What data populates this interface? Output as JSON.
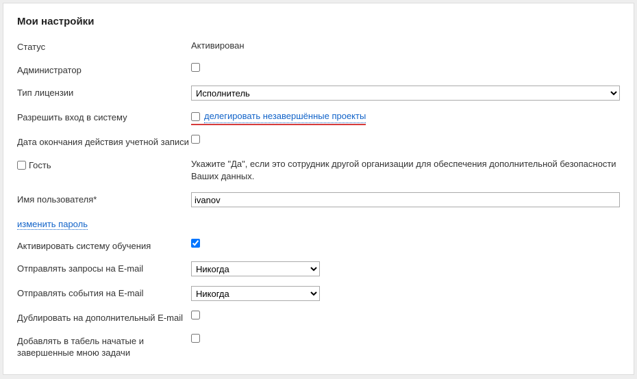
{
  "title": "Мои настройки",
  "rows": {
    "status": {
      "label": "Статус",
      "value": "Активирован"
    },
    "admin": {
      "label": "Администратор"
    },
    "licenseType": {
      "label": "Тип лицензии",
      "selected": "Исполнитель"
    },
    "allowLogin": {
      "label": "Разрешить вход в систему",
      "link": "делегировать незавершённые проекты"
    },
    "accountEnd": {
      "label": "Дата окончания действия учетной записи"
    },
    "guest": {
      "label": "Гость",
      "hint": "Укажите \"Да\", если это сотрудник другой организации для обеспечения дополнительной безопасности Ваших данных."
    },
    "username": {
      "label": "Имя пользователя*",
      "value": "ivanov"
    },
    "changePassword": {
      "label": "изменить пароль"
    },
    "activateLearning": {
      "label": "Активировать систему обучения"
    },
    "emailRequests": {
      "label": "Отправлять запросы на E-mail",
      "selected": "Никогда"
    },
    "emailEvents": {
      "label": "Отправлять события на E-mail",
      "selected": "Никогда"
    },
    "duplicateEmail": {
      "label": "Дублировать на дополнительный E-mail"
    },
    "addToTimesheet": {
      "label": "Добавлять в табель начатые и завершенные мною задачи"
    }
  }
}
